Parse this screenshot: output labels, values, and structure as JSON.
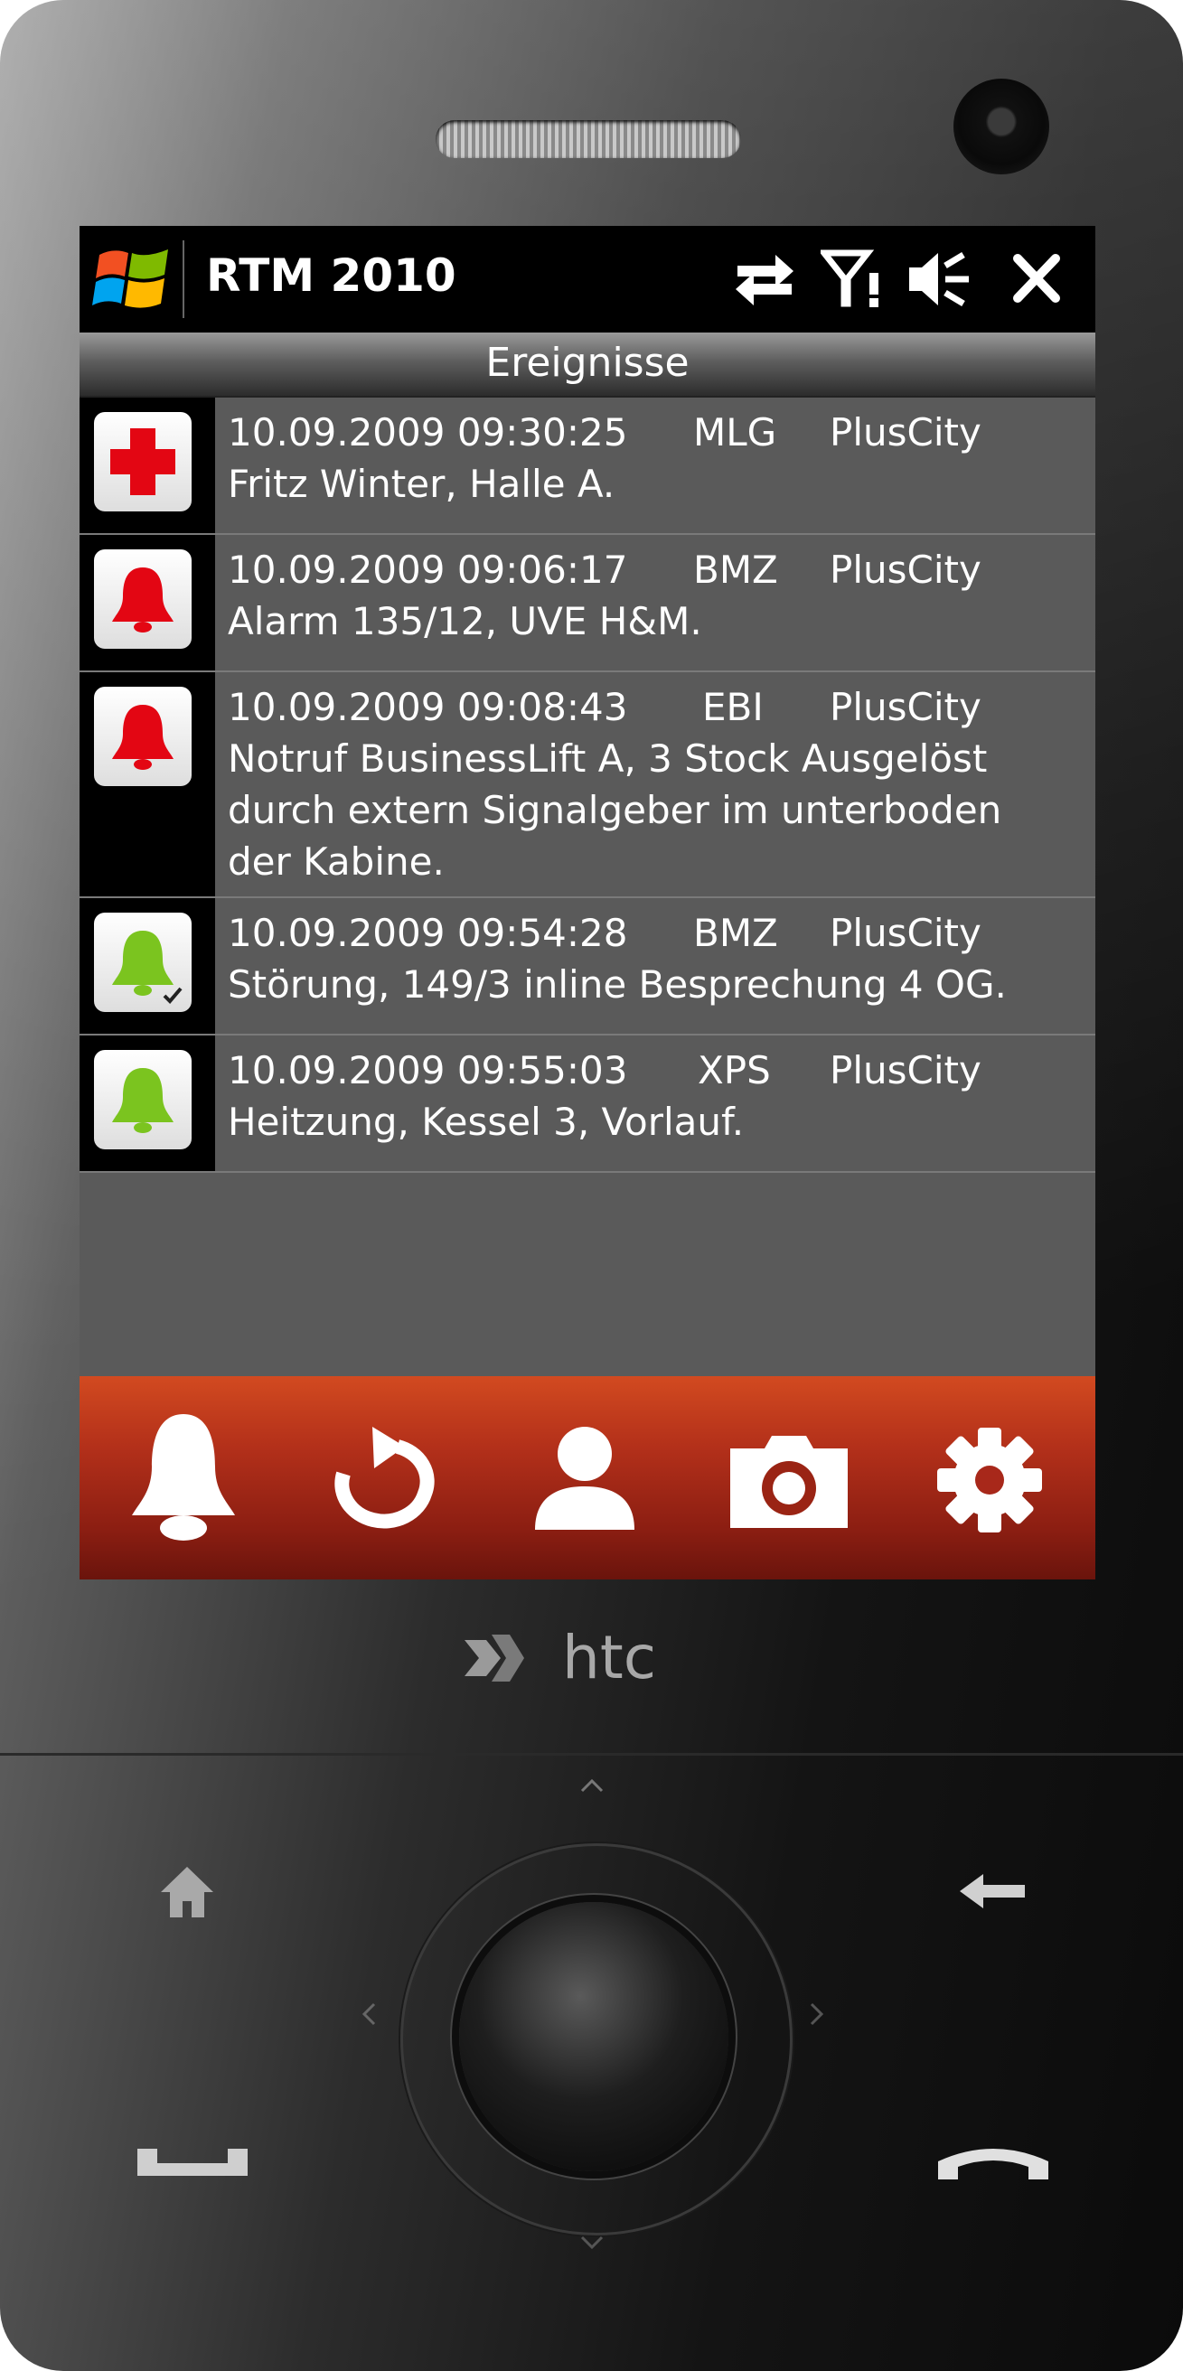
{
  "device": {
    "brand": "htc"
  },
  "titlebar": {
    "app_title": "RTM 2010",
    "icons": [
      "windows-start-icon",
      "connectivity-icon",
      "signal-icon",
      "volume-icon",
      "close-icon"
    ]
  },
  "header": {
    "title": "Ereignisse"
  },
  "events": [
    {
      "date": "10.09.2009 09:30:25",
      "code": "MLG",
      "site": "PlusCity",
      "desc": "Fritz Winter, Halle A.",
      "icon": "red-cross-icon"
    },
    {
      "date": "10.09.2009 09:06:17",
      "code": "BMZ",
      "site": "PlusCity",
      "desc": "Alarm 135/12, UVE H&M.",
      "icon": "red-bell-icon"
    },
    {
      "date": "10.09.2009 09:08:43",
      "code": "EBI",
      "site": "PlusCity",
      "desc": "Notruf BusinessLift A, 3 Stock Ausgelöst\ndurch extern Signalgeber im unterboden\nder Kabine.",
      "icon": "red-bell-icon"
    },
    {
      "date": "10.09.2009 09:54:28",
      "code": "BMZ",
      "site": "PlusCity",
      "desc": "Störung, 149/3 inline Besprechung 4 OG.",
      "icon": "green-bell-checked-icon"
    },
    {
      "date": "10.09.2009 09:55:03",
      "code": "XPS",
      "site": "PlusCity",
      "desc": "Heitzung, Kessel 3, Vorlauf.",
      "icon": "green-bell-icon"
    }
  ],
  "toolbar": {
    "buttons": [
      "bell-icon",
      "refresh-icon",
      "user-icon",
      "camera-icon",
      "settings-icon"
    ]
  },
  "hardware_buttons": [
    "home-icon",
    "back-icon",
    "call-icon",
    "end-call-icon",
    "dpad"
  ],
  "colors": {
    "alarm_red": "#e30613",
    "ok_green": "#7bc41f",
    "toolbar_orange": "#c0391b"
  }
}
